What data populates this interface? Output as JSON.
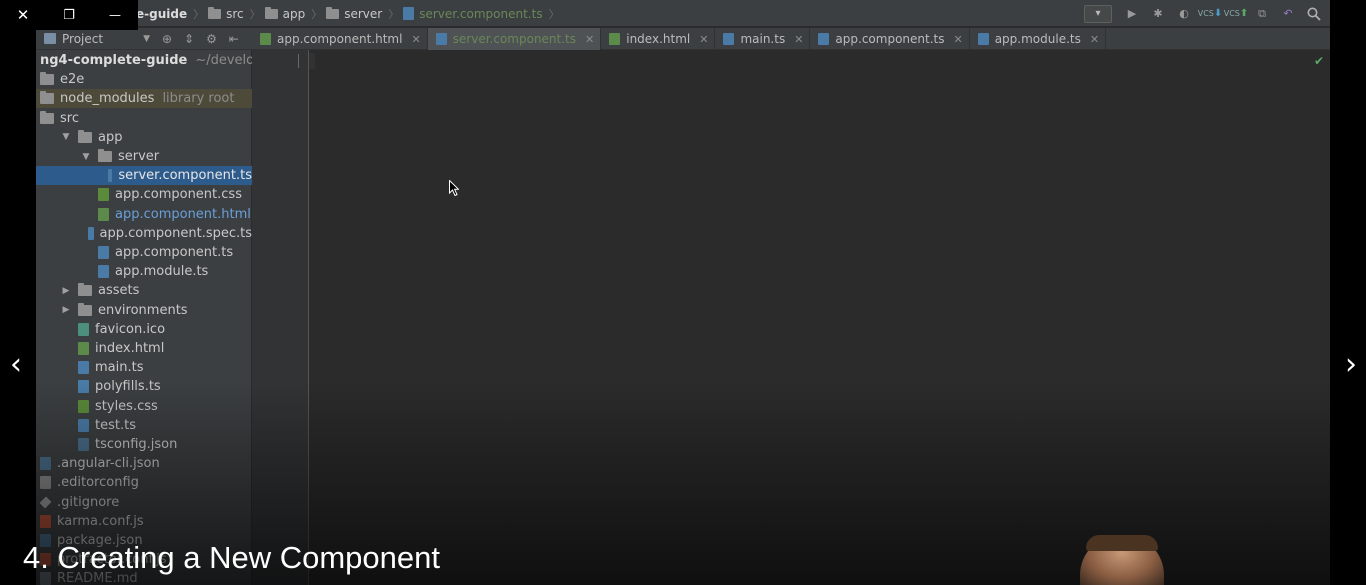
{
  "window": {
    "close": "✕",
    "restore": "❐",
    "minimize": "—"
  },
  "breadcrumbs": [
    "e-guide",
    "src",
    "app",
    "server",
    "server.component.ts"
  ],
  "nav_tools": [
    "dropdown",
    "run-icon",
    "debug-icon",
    "coverage-icon",
    "vcs-update-icon",
    "vcs-commit-icon",
    "compare-icon",
    "revert-icon",
    "search-icon"
  ],
  "vcs": {
    "update": "VCS",
    "commit": "VCS"
  },
  "project_bar": {
    "label": "Project"
  },
  "tabs": [
    {
      "label": "app.component.html",
      "type": "html",
      "active": false
    },
    {
      "label": "server.component.ts",
      "type": "ts",
      "active": true
    },
    {
      "label": "index.html",
      "type": "html",
      "active": false
    },
    {
      "label": "main.ts",
      "type": "ts",
      "active": false
    },
    {
      "label": "app.component.ts",
      "type": "ts",
      "active": false
    },
    {
      "label": "app.module.ts",
      "type": "ts",
      "active": false
    }
  ],
  "tree": [
    {
      "label": "ng4-complete-guide",
      "extra": "~/developm",
      "kind": "root",
      "indent": 0
    },
    {
      "label": "e2e",
      "kind": "folder",
      "indent": 0
    },
    {
      "label": "node_modules",
      "extra": "library root",
      "kind": "folder-lib",
      "indent": 0
    },
    {
      "label": "src",
      "kind": "folder",
      "indent": 0
    },
    {
      "label": "app",
      "kind": "folder-open",
      "indent": 1
    },
    {
      "label": "server",
      "kind": "folder-open",
      "indent": 2
    },
    {
      "label": "server.component.ts",
      "kind": "ts",
      "indent": 3,
      "selected": true
    },
    {
      "label": "app.component.css",
      "kind": "css",
      "indent": 2
    },
    {
      "label": "app.component.html",
      "kind": "html",
      "indent": 2,
      "modified": true
    },
    {
      "label": "app.component.spec.ts",
      "kind": "ts",
      "indent": 2
    },
    {
      "label": "app.component.ts",
      "kind": "ts",
      "indent": 2
    },
    {
      "label": "app.module.ts",
      "kind": "ts",
      "indent": 2
    },
    {
      "label": "assets",
      "kind": "folder-closed",
      "indent": 1
    },
    {
      "label": "environments",
      "kind": "folder-closed",
      "indent": 1
    },
    {
      "label": "favicon.ico",
      "kind": "ico",
      "indent": 1
    },
    {
      "label": "index.html",
      "kind": "html",
      "indent": 1
    },
    {
      "label": "main.ts",
      "kind": "ts",
      "indent": 1
    },
    {
      "label": "polyfills.ts",
      "kind": "ts",
      "indent": 1
    },
    {
      "label": "styles.css",
      "kind": "css",
      "indent": 1
    },
    {
      "label": "test.ts",
      "kind": "ts",
      "indent": 1
    },
    {
      "label": "tsconfig.json",
      "kind": "json",
      "indent": 1
    },
    {
      "label": ".angular-cli.json",
      "kind": "json",
      "indent": 0
    },
    {
      "label": ".editorconfig",
      "kind": "text",
      "indent": 0
    },
    {
      "label": ".gitignore",
      "kind": "git",
      "indent": 0
    },
    {
      "label": "karma.conf.js",
      "kind": "karma",
      "indent": 0
    },
    {
      "label": "package.json",
      "kind": "json",
      "indent": 0
    },
    {
      "label": "protractor.conf.js",
      "kind": "karma",
      "indent": 0
    },
    {
      "label": "README.md",
      "kind": "md",
      "indent": 0
    }
  ],
  "video": {
    "caption": "4. Creating a New Component",
    "prev": "‹",
    "next": "›"
  },
  "colors": {
    "accent": "#2d5b8c",
    "editor_bg": "#2b2b2b",
    "panel_bg": "#3c3f41",
    "ok": "#59a869"
  }
}
